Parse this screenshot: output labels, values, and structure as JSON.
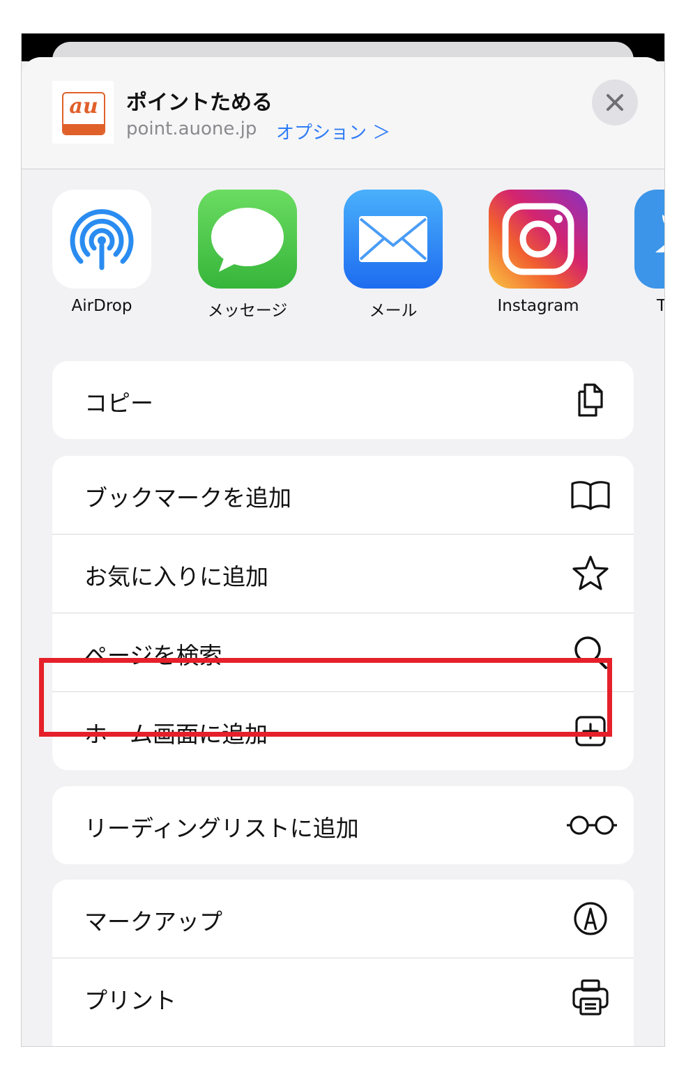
{
  "header": {
    "title": "ポイントためる",
    "domain": "point.auone.jp",
    "options_label": "オプション ＞",
    "site_logo_text": "au"
  },
  "apps": [
    {
      "label": "AirDrop",
      "icon": "airdrop-icon"
    },
    {
      "label": "メッセージ",
      "icon": "messages-icon"
    },
    {
      "label": "メール",
      "icon": "mail-icon"
    },
    {
      "label": "Instagram",
      "icon": "instagram-icon"
    },
    {
      "label": "T",
      "icon": "twitter-icon"
    }
  ],
  "groups": [
    [
      {
        "label": "コピー",
        "icon": "copy-icon"
      }
    ],
    [
      {
        "label": "ブックマークを追加",
        "icon": "book-icon"
      },
      {
        "label": "お気に入りに追加",
        "icon": "star-icon"
      },
      {
        "label": "ページを検索",
        "icon": "search-icon"
      },
      {
        "label": "ホーム画面に追加",
        "icon": "plus-square-icon"
      }
    ],
    [
      {
        "label": "リーディングリストに追加",
        "icon": "glasses-icon"
      }
    ],
    [
      {
        "label": "マークアップ",
        "icon": "markup-icon"
      },
      {
        "label": "プリント",
        "icon": "print-icon"
      }
    ]
  ],
  "colors": {
    "accent": "#2f7cf6",
    "highlight": "#e5202a",
    "au_orange": "#e0602a"
  }
}
